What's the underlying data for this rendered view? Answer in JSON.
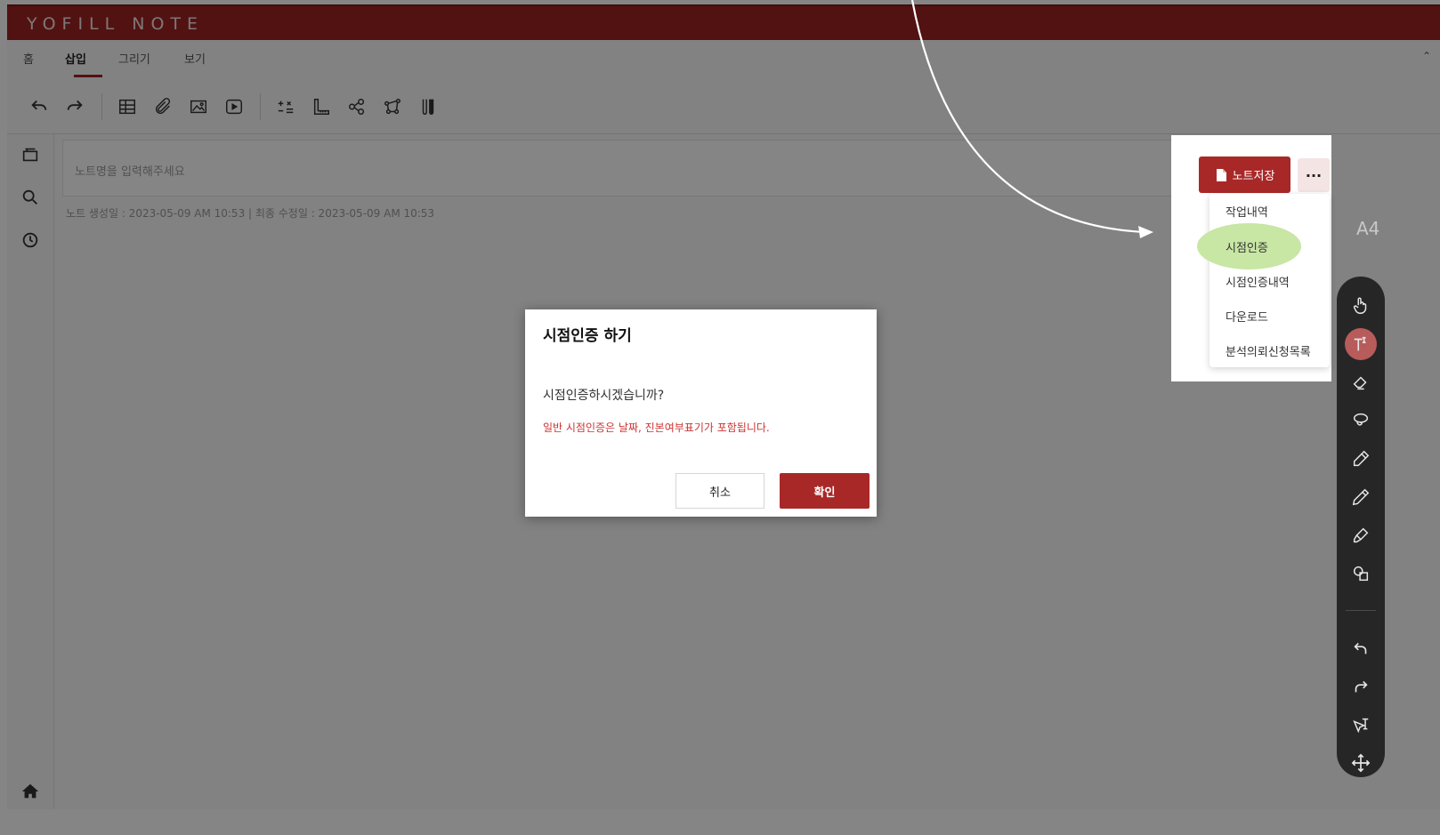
{
  "app": {
    "brand": "YOFILL NOTE"
  },
  "tabs": [
    {
      "label": "홈"
    },
    {
      "label": "삽입"
    },
    {
      "label": "그리기"
    },
    {
      "label": "보기"
    }
  ],
  "active_tab": "삽입",
  "toolbar": {
    "icons": [
      "undo-icon",
      "redo-icon",
      "table-icon",
      "attachment-icon",
      "image-icon",
      "video-icon",
      "formula-icon",
      "ruler-icon",
      "share-icon",
      "molecule-icon",
      "tube-icon"
    ]
  },
  "note": {
    "title_placeholder": "노트명을 입력해주세요",
    "meta": "노트 생성일 : 2023-05-09 AM 10:53   |   최종 수정일 : 2023-05-09 AM 10:53"
  },
  "actions": {
    "save_label": "노트저장",
    "more_label": "···"
  },
  "menu": {
    "items": [
      {
        "label": "작업내역"
      },
      {
        "label": "시점인증"
      },
      {
        "label": "시점인증내역"
      },
      {
        "label": "다운로드"
      },
      {
        "label": "분석의뢰신청목록"
      }
    ],
    "highlighted": "시점인증"
  },
  "page_size": "A4",
  "dialog": {
    "title": "시점인증 하기",
    "question": "시점인증하시겠습니까?",
    "note": "일반 시점인증은 날짜, 진본여부표기가 포함됩니다.",
    "cancel_label": "취소",
    "confirm_label": "확인"
  },
  "colors": {
    "brand": "#9e2424",
    "button_primary": "#a82828",
    "highlight": "#c8e6a4",
    "warning_text": "#cc3333"
  }
}
